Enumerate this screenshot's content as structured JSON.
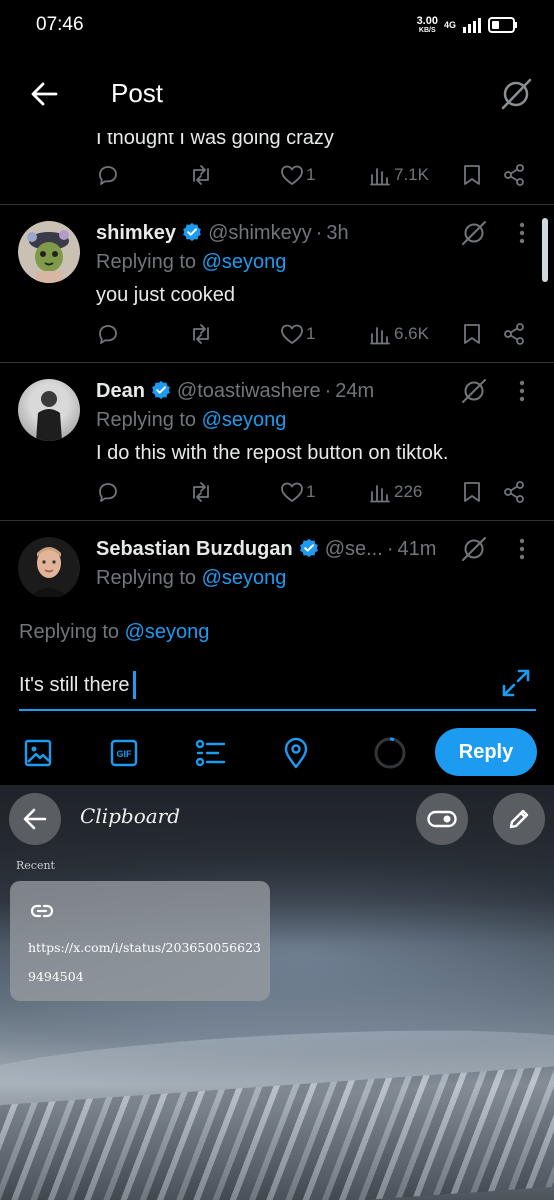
{
  "status_bar": {
    "time": "07:46",
    "speed_value": "3.00",
    "speed_unit": "KB/S",
    "network": "4G"
  },
  "header": {
    "title": "Post"
  },
  "partial_tweet": {
    "text": "I thought I was going crazy",
    "views": "7.1K",
    "likes": "1"
  },
  "tweets": [
    {
      "name": "shimkey",
      "handle": "@shimkeyy",
      "time": "3h",
      "replying_prefix": "Replying to",
      "replying_to": "@seyong",
      "text": "you just cooked",
      "likes": "1",
      "views": "6.6K"
    },
    {
      "name": "Dean",
      "handle": "@toastiwashere",
      "time": "24m",
      "replying_prefix": "Replying to",
      "replying_to": "@seyong",
      "text": "I do this with the repost button on tiktok.",
      "likes": "1",
      "views": "226"
    },
    {
      "name": "Sebastian Buzdugan",
      "handle": "@se...",
      "time": "41m",
      "replying_prefix": "Replying to",
      "replying_to": "@seyong"
    }
  ],
  "composer": {
    "replying_prefix": "Replying to",
    "replying_to": "@seyong",
    "input_value": "It's still there",
    "reply_label": "Reply"
  },
  "clipboard": {
    "title": "Clipboard",
    "section_label": "Recent",
    "items": [
      {
        "text": "https://x.com/i/status/2036500566239494504"
      }
    ]
  },
  "colors": {
    "accent": "#1d9bf0",
    "muted": "#71767b",
    "background": "#000000"
  }
}
